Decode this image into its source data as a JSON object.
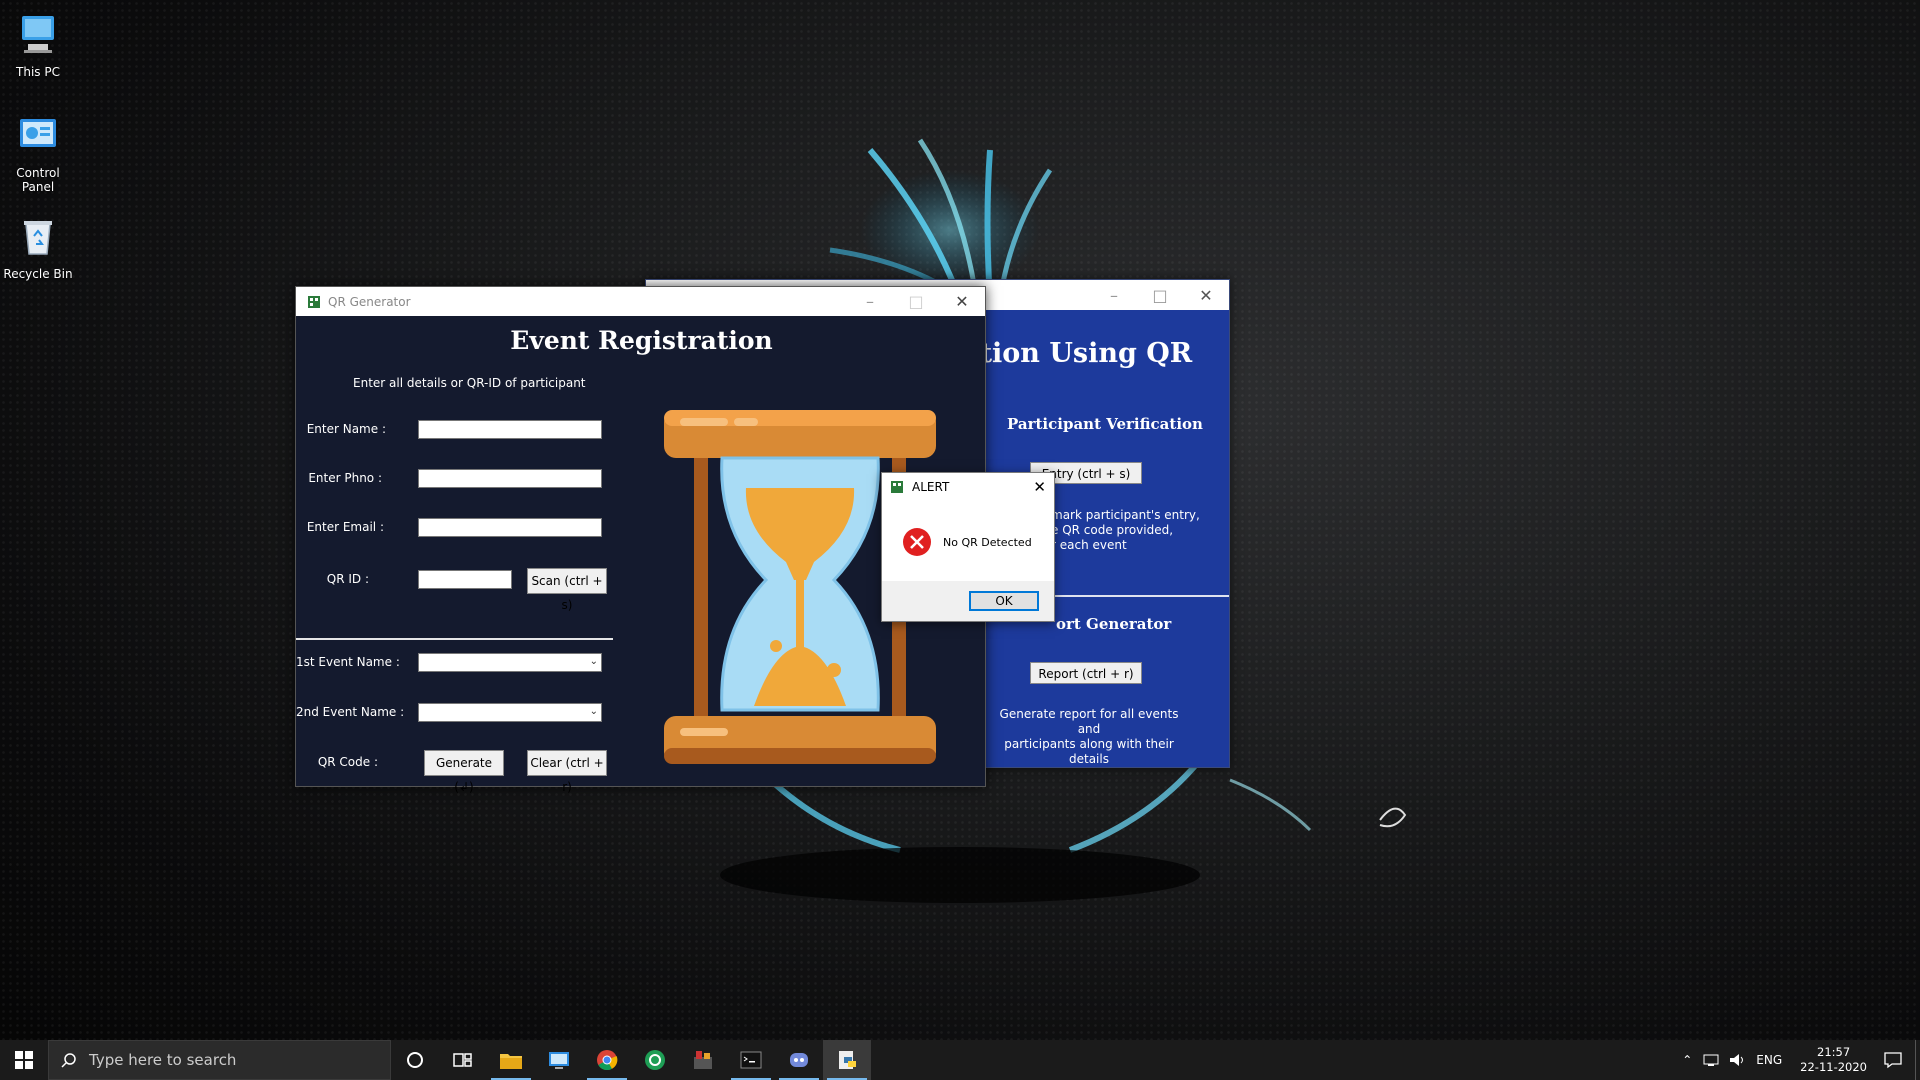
{
  "desktop": {
    "icons": [
      {
        "label": "This PC",
        "icon": "computer-icon"
      },
      {
        "label": "Control Panel",
        "icon": "control-panel-icon"
      },
      {
        "label": "Recycle Bin",
        "icon": "recycle-bin-icon"
      }
    ]
  },
  "verification_window": {
    "title_text": "fication Using QR",
    "participant_heading": "Participant Verification",
    "entry_button": "Entry (ctrl + s)",
    "entry_desc": [
      "mark participant's entry,",
      "e QR code provided,",
      "r each event"
    ],
    "report_heading": "ort Generator",
    "report_button": "Report (ctrl + r)",
    "report_desc": [
      "Generate report for all events and",
      "participants along with their details"
    ]
  },
  "qr_window": {
    "title": "QR Generator",
    "heading": "Event Registration",
    "subheading": "Enter all details or QR-ID of participant",
    "name_label": "Enter Name :",
    "phone_label": "Enter Phno :",
    "email_label": "Enter Email :",
    "qrid_label": "QR ID :",
    "scan_button": "Scan (ctrl + s)",
    "event1_label": "1st Event Name :",
    "event2_label": "2nd Event Name :",
    "qrcode_label": "QR Code :",
    "generate_button": "Generate (↲)",
    "clear_button": "Clear (ctrl + r)",
    "name_value": "",
    "phone_value": "",
    "email_value": "",
    "qrid_value": "",
    "event1_value": "",
    "event2_value": ""
  },
  "alert": {
    "title": "ALERT",
    "message": "No QR Detected",
    "ok_button": "OK"
  },
  "taskbar": {
    "search_placeholder": "Type here to search",
    "language": "ENG",
    "time": "21:57",
    "date": "22-11-2020"
  },
  "colors": {
    "window_bg": "#141a2e",
    "verification_bg": "#1d3a9c",
    "accent": "#0078d7",
    "taskbar": "#1b1b1b"
  }
}
